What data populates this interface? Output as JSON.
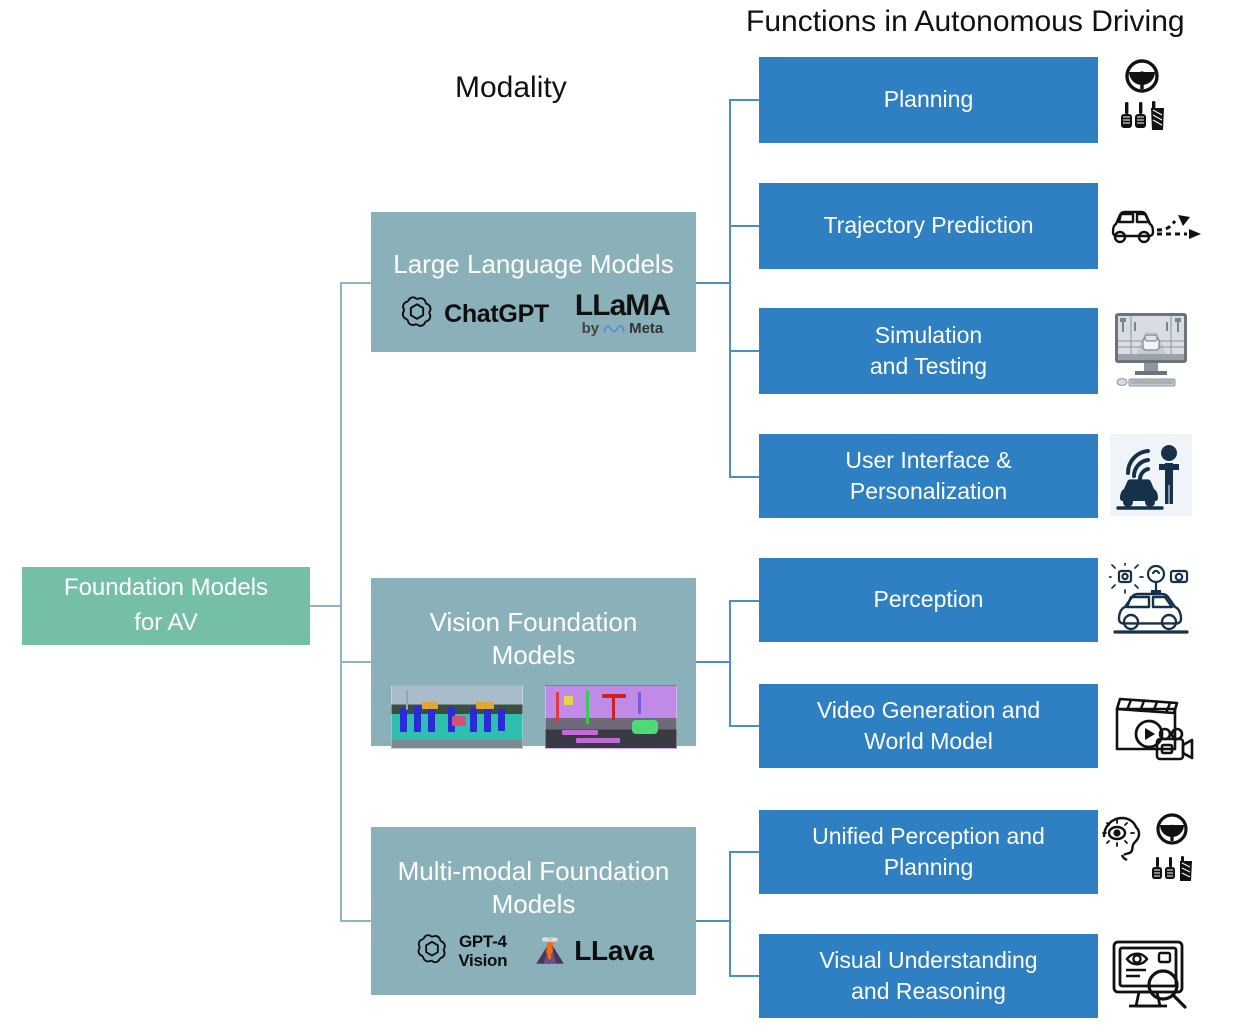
{
  "headers": {
    "functions": "Functions in Autonomous Driving",
    "modality": "Modality"
  },
  "root": {
    "line1": "Foundation Models",
    "line2": "for AV",
    "color": "#74BFA5"
  },
  "modality_color": "#8AB0BA",
  "function_color": "#2E80C2",
  "connector_color": "#4A90C6",
  "modalities": [
    {
      "id": "llm",
      "title": "Large Language Models",
      "logos": [
        {
          "name": "chatgpt-logo",
          "label": "ChatGPT"
        },
        {
          "name": "llama-meta-logo",
          "label_top": "LLaMA",
          "label_by": "by",
          "label_bottom": "Meta"
        }
      ]
    },
    {
      "id": "vfm",
      "title_line1": "Vision Foundation",
      "title_line2": "Models",
      "images": [
        {
          "name": "segmentation-pedestrians-image"
        },
        {
          "name": "segmentation-street-image"
        }
      ]
    },
    {
      "id": "mmfm",
      "title_line1": "Multi-modal Foundation",
      "title_line2": "Models",
      "logos": [
        {
          "name": "gpt4-vision-logo",
          "label_top": "GPT-4",
          "label_bottom": "Vision"
        },
        {
          "name": "llava-logo",
          "label": "LLava"
        }
      ]
    }
  ],
  "functions": [
    {
      "id": "planning",
      "label": "Planning",
      "icon": "steering-wheel-pedals-icon",
      "group": "llm"
    },
    {
      "id": "trajectory-prediction",
      "label": "Trajectory Prediction",
      "icon": "car-trajectory-arrows-icon",
      "group": "llm"
    },
    {
      "id": "simulation-and-testing",
      "line1": "Simulation",
      "line2": "and Testing",
      "icon": "desktop-simulation-icon",
      "group": "llm"
    },
    {
      "id": "user-interface-personalization",
      "line1": "User Interface &",
      "line2": "Personalization",
      "icon": "car-person-signal-icon",
      "group": "llm"
    },
    {
      "id": "perception",
      "label": "Perception",
      "icon": "sensor-car-icon",
      "group": "vfm"
    },
    {
      "id": "video-generation-world-model",
      "line1": "Video Generation and",
      "line2": "World Model",
      "icon": "clapperboard-camera-icon",
      "group": "vfm"
    },
    {
      "id": "unified-perception-planning",
      "line1": "Unified Perception and",
      "line2": "Planning",
      "icon": "brain-steering-wheel-icon",
      "group": "mmfm"
    },
    {
      "id": "visual-understanding-reasoning",
      "line1": "Visual Understanding",
      "line2": "and Reasoning",
      "icon": "monitor-eye-magnifier-icon",
      "group": "mmfm"
    }
  ]
}
